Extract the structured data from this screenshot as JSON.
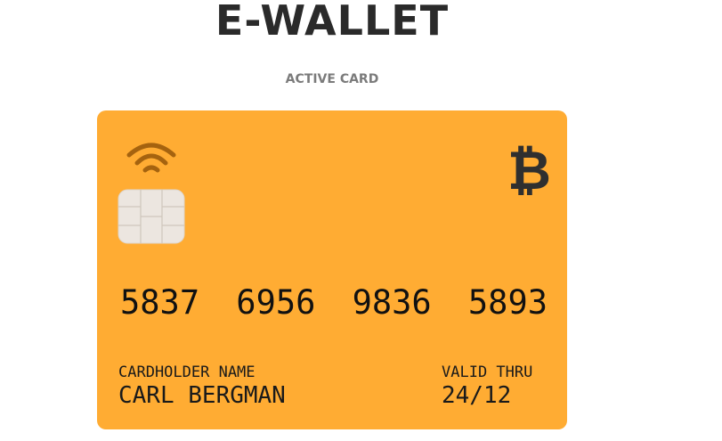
{
  "header": {
    "title": "E-WALLET",
    "section_label": "ACTIVE CARD"
  },
  "card": {
    "background_color": "#ffac33",
    "contactless_icon": "wifi-contactless-icon",
    "chip_icon": "emv-chip-icon",
    "network_icon": "bitcoin-icon",
    "network_symbol": "₿",
    "number_groups": [
      "5837",
      "6956",
      "9836",
      "5893"
    ],
    "holder": {
      "label": "CARDHOLDER NAME",
      "value": "CARL BERGMAN"
    },
    "valid": {
      "label": "VALID THRU",
      "value": "24/12"
    }
  }
}
